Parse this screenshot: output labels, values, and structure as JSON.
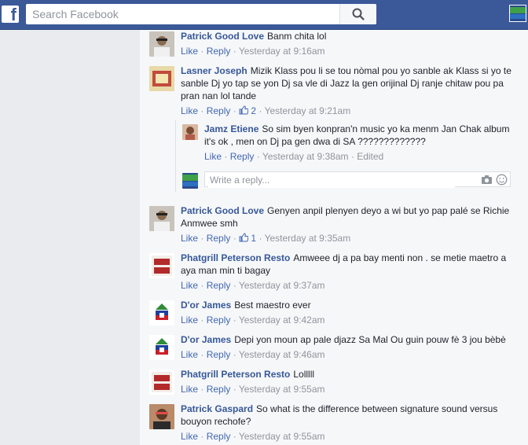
{
  "topbar": {
    "logo_letter": "f",
    "search_placeholder": "Search Facebook"
  },
  "actions": {
    "like": "Like",
    "reply": "Reply",
    "dot": "·"
  },
  "comments": [
    {
      "name": "Patrick Good Love",
      "text": "Banm chita lol",
      "time": "Yesterday at 9:16am"
    },
    {
      "name": "Lasner Joseph",
      "text": "Mizik Klass pou li se tou nòmal pou yo sanble ak Klass si yo te sanble Dj yo tap se yon Dj sa vle di Jazz la gen orijinal Dj ranje chitaw pou pa pran nan lol tande",
      "likes": "2",
      "time": "Yesterday at 9:21am"
    },
    {
      "name": "Patrick Good Love",
      "text": "Genyen anpil plenyen deyo a wi but yo pap palé se Richie Anmwee smh",
      "likes": "1",
      "time": "Yesterday at 9:35am"
    },
    {
      "name": "Phatgrill Peterson Resto",
      "text": "Amweee dj a pa bay menti non . se metie maetro a aya man min ti bagay",
      "time": "Yesterday at 9:37am"
    },
    {
      "name": "D'or James",
      "text": "Best maestro ever",
      "time": "Yesterday at 9:42am"
    },
    {
      "name": "D'or James",
      "text": "Depi yon moun ap pale djazz Sa Mal Ou guin pouw fè 3 jou bèbè",
      "time": "Yesterday at 9:46am"
    },
    {
      "name": "Phatgrill Peterson Resto",
      "text": "Lolllll",
      "time": "Yesterday at 9:55am"
    },
    {
      "name": "Patrick Gaspard",
      "text": "So what is the difference between signature sound versus bouyon rechofe?",
      "time": "Yesterday at 9:55am"
    }
  ],
  "reply": {
    "name": "Jamz Etiene",
    "text": "So sim byen konpran'n music yo ka menm Jan Chak album it's ok , men on Dj pa gen dwa di SA ?????????????",
    "time": "Yesterday at 9:38am",
    "edited": "Edited"
  },
  "write_reply_placeholder": "Write a reply...",
  "colors": {
    "brand": "#3b5998",
    "link": "#365899",
    "action": "#4267b2",
    "meta": "#90949c"
  }
}
